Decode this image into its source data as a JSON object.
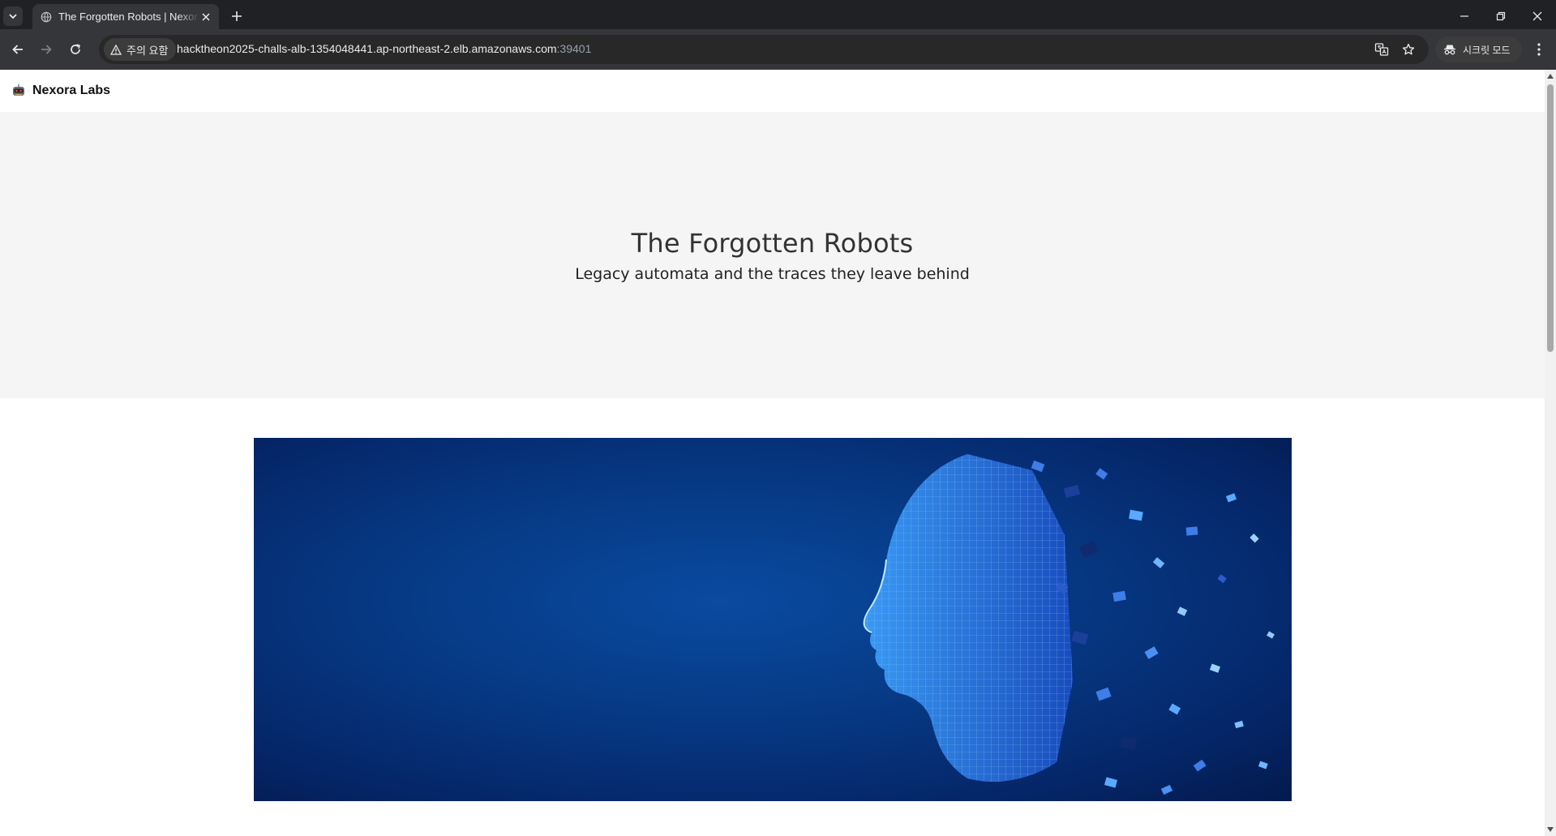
{
  "browser": {
    "tab_title": "The Forgotten Robots | Nexora Labs",
    "security_warning": "주의 요함",
    "url_host": "hacktheon2025-challs-alb-1354048441.ap-northeast-2.elb.amazonaws.com",
    "url_port": ":39401",
    "incognito_label": "시크릿 모드",
    "colors": {
      "chrome_dark": "#202124",
      "toolbar": "#35363a"
    }
  },
  "site": {
    "brand": "Nexora Labs",
    "hero_title": "The Forgotten Robots",
    "hero_subtitle": "Legacy automata and the traces they leave behind",
    "banner_image": "ai-face-wireframe-disintegrating"
  }
}
